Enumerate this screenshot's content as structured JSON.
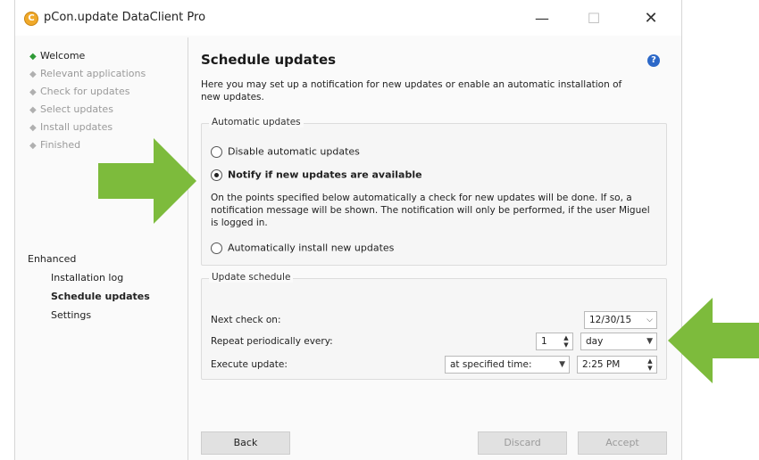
{
  "window": {
    "title": "pCon.update DataClient Pro",
    "controls": {
      "minimize": "—",
      "maximize": "☐",
      "close": "✕"
    },
    "app_icon_letter": "C"
  },
  "sidebar": {
    "steps": [
      {
        "label": "Welcome",
        "active": true
      },
      {
        "label": "Relevant applications",
        "active": false
      },
      {
        "label": "Check for updates",
        "active": false
      },
      {
        "label": "Select updates",
        "active": false
      },
      {
        "label": "Install updates",
        "active": false
      },
      {
        "label": "Finished",
        "active": false
      }
    ],
    "enhanced_heading": "Enhanced",
    "enhanced_items": [
      {
        "label": "Installation log",
        "selected": false
      },
      {
        "label": "Schedule updates",
        "selected": true
      },
      {
        "label": "Settings",
        "selected": false
      }
    ]
  },
  "main": {
    "title": "Schedule updates",
    "help_icon": "?",
    "intro": "Here you may set up a notification for new updates or enable an automatic installation of new updates.",
    "automatic_updates": {
      "legend": "Automatic updates",
      "options": [
        {
          "label": "Disable automatic updates",
          "checked": false
        },
        {
          "label": "Notify if new updates are available",
          "checked": true
        },
        {
          "label": "Automatically install new updates",
          "checked": false
        }
      ],
      "description": "On the points specified below automatically a check for new updates will be done. If so, a notification message will be shown. The notification will only be performed, if the user Miguel is logged in."
    },
    "update_schedule": {
      "legend": "Update schedule",
      "next_check_label": "Next check on:",
      "next_check_value": "12/30/15",
      "repeat_label": "Repeat periodically every:",
      "repeat_value": "1",
      "repeat_unit": "day",
      "execute_label": "Execute update:",
      "execute_mode": "at specified time:",
      "execute_time": "2:25 PM"
    },
    "buttons": {
      "back": "Back",
      "discard": "Discard",
      "accept": "Accept"
    }
  },
  "colors": {
    "annotation_arrow": "#7dbb3c",
    "help_icon": "#2c68c8",
    "active_step": "#2f9a36",
    "app_icon": "#f0a92a"
  }
}
